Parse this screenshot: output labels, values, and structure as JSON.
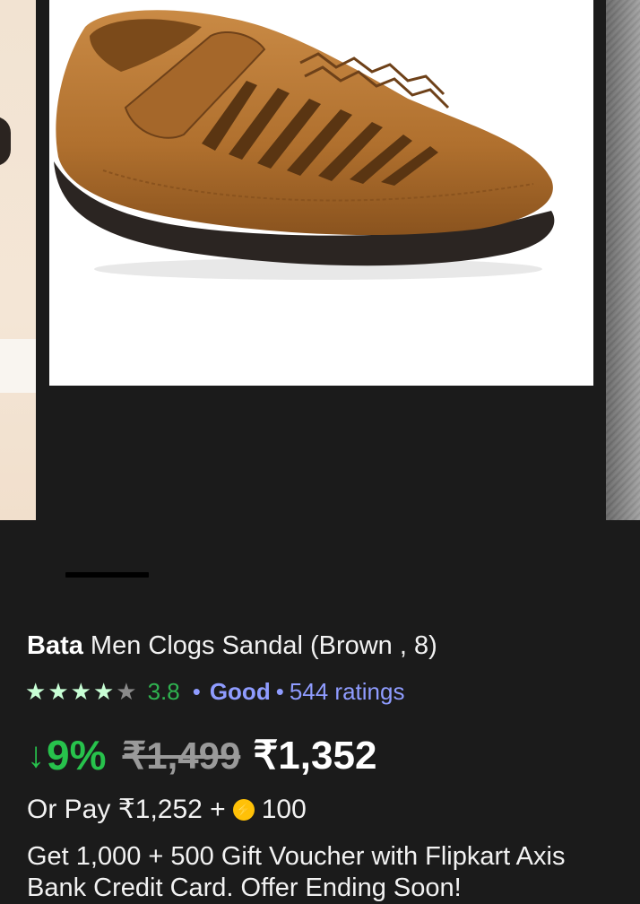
{
  "product": {
    "brand": "Bata",
    "name": "Men Clogs Sandal (Brown , 8)"
  },
  "rating": {
    "value": "3.8",
    "stars_filled": 4,
    "stars_total": 5,
    "separator": "•",
    "label": "Good",
    "count_text": "544 ratings"
  },
  "pricing": {
    "arrow": "↓",
    "discount": "9%",
    "mrp": "₹1,499",
    "price": "₹1,352"
  },
  "pay": {
    "prefix": "Or Pay ₹1,252 +",
    "coin_icon": "lightning-coin-icon",
    "coins": "100"
  },
  "offer": {
    "text": "Get 1,000 + 500 Gift Voucher with Flipkart Axis Bank Credit Card. Offer Ending Soon!"
  },
  "colors": {
    "background": "#1b1b1b",
    "discount_green": "#27c24c",
    "rating_green": "#2fb350",
    "link_blue": "#8f9cff",
    "coin_yellow": "#ffc107",
    "shoe_brown": "#b0702e"
  }
}
